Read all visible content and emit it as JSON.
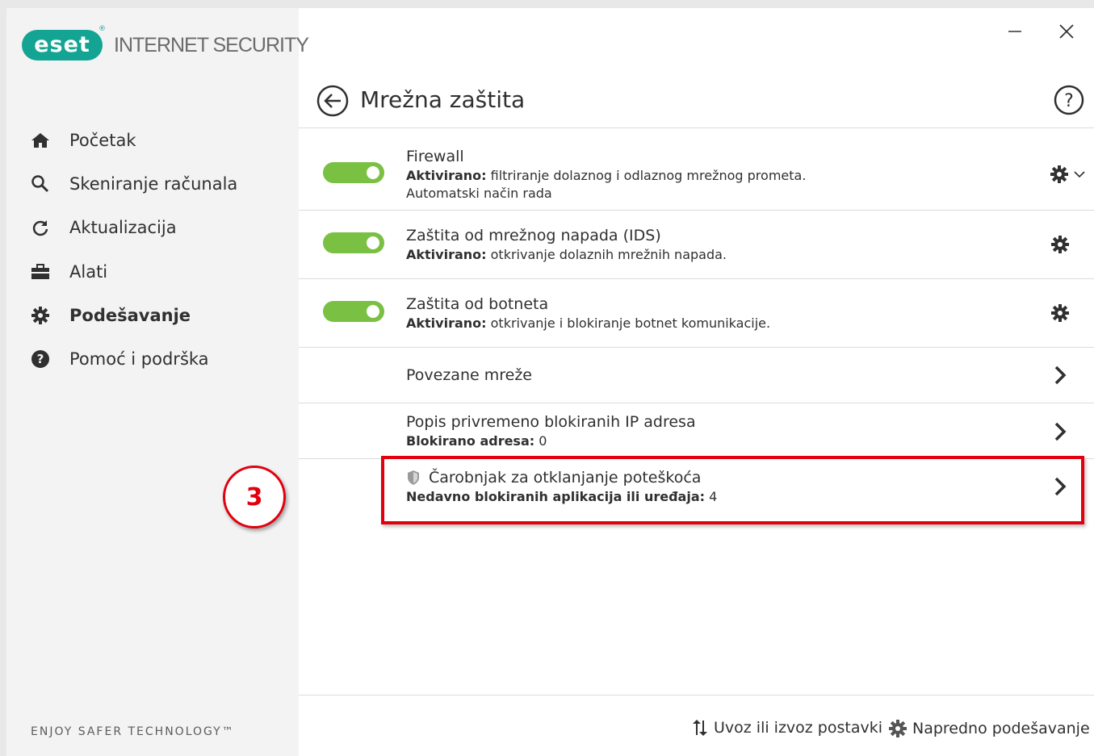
{
  "app": {
    "logo_text": "eset",
    "logo_reg": "®",
    "product_name": "INTERNET SECURITY",
    "tagline": "ENJOY SAFER TECHNOLOGY™"
  },
  "window_controls": {
    "minimize": "—",
    "close": "✕"
  },
  "sidebar": {
    "items": [
      {
        "label": "Početak",
        "icon": "home-icon"
      },
      {
        "label": "Skeniranje računala",
        "icon": "search-icon"
      },
      {
        "label": "Aktualizacija",
        "icon": "refresh-icon"
      },
      {
        "label": "Alati",
        "icon": "briefcase-icon"
      },
      {
        "label": "Podešavanje",
        "icon": "gear-icon",
        "active": true
      },
      {
        "label": "Pomoć i podrška",
        "icon": "question-icon"
      }
    ]
  },
  "header": {
    "title": "Mrežna zaštita",
    "help": "?"
  },
  "rows": [
    {
      "title": "Firewall",
      "status_label": "Aktivirano:",
      "status_text": " filtriranje dolaznog i odlaznog mrežnog prometa.",
      "extra": "Automatski način rada",
      "enabled": true
    },
    {
      "title": "Zaštita od mrežnog napada (IDS)",
      "status_label": "Aktivirano:",
      "status_text": " otkrivanje dolaznih mrežnih napada.",
      "enabled": true
    },
    {
      "title": "Zaštita od botneta",
      "status_label": "Aktivirano:",
      "status_text": " otkrivanje i blokiranje botnet komunikacije.",
      "enabled": true
    },
    {
      "title": "Povezane mreže"
    },
    {
      "title": "Popis privremeno blokiranih IP adresa",
      "status_label": "Blokirano adresa:",
      "status_text": " 0"
    },
    {
      "title": "Čarobnjak za otklanjanje poteškoća",
      "status_label": "Nedavno blokiranih aplikacija ili uređaja:",
      "status_text": " 4"
    }
  ],
  "annotation": {
    "step": "3",
    "color": "#e2000f"
  },
  "footer": {
    "import_export": "Uvoz ili izvoz postavki",
    "advanced": "Napredno podešavanje"
  },
  "colors": {
    "brand": "#14a494",
    "toggle_on": "#7ac043"
  }
}
